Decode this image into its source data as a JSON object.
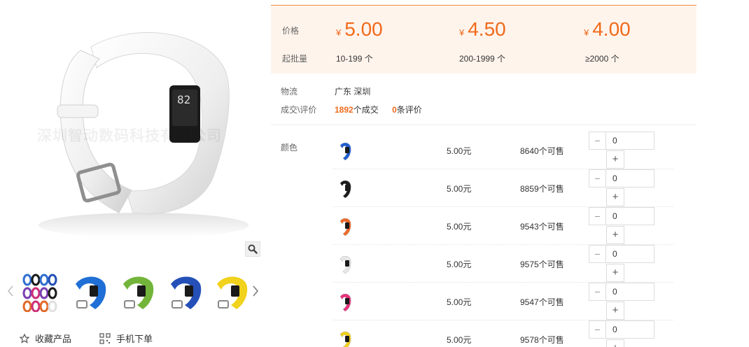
{
  "gallery": {
    "watermark": "深圳智动数码科技有限公司",
    "display_digits": "82",
    "thumbnails": [
      {
        "name": "multi-color",
        "colors": [
          "#2f6fd0",
          "#7a3fb0",
          "#e36a2a",
          "#cc2f7a",
          "#1a1a1a",
          "#e0e0e0"
        ]
      },
      {
        "name": "blue",
        "color": "#1f6fd6"
      },
      {
        "name": "green",
        "color": "#72b53a"
      },
      {
        "name": "royal-blue",
        "color": "#2450b8"
      },
      {
        "name": "yellow",
        "color": "#f1d21c"
      }
    ],
    "favorite_label": "收藏产品",
    "mobile_order_label": "手机下单"
  },
  "price_box": {
    "price_label": "价格",
    "moq_label": "起批量",
    "currency": "¥",
    "tiers": [
      {
        "price": "5.00",
        "qty": "10-199 个"
      },
      {
        "price": "4.50",
        "qty": "200-1999 个"
      },
      {
        "price": "4.00",
        "qty": "≥2000 个"
      }
    ]
  },
  "logistics": {
    "label": "物流",
    "location": "广东 深圳",
    "deals_label": "成交\\评价",
    "deals_count": "1892",
    "deals_suffix": "个成交",
    "reviews_count": "0",
    "reviews_suffix": "条评价"
  },
  "sku": {
    "color_label": "颜色",
    "rows": [
      {
        "color": "#1f5fd0",
        "price": "5.00元",
        "stock": "8640个可售",
        "qty": "0"
      },
      {
        "color": "#1c1c1c",
        "price": "5.00元",
        "stock": "8859个可售",
        "qty": "0"
      },
      {
        "color": "#ef6a2a",
        "price": "5.00元",
        "stock": "9543个可售",
        "qty": "0"
      },
      {
        "color": "#e8e8e8",
        "price": "5.00元",
        "stock": "9575个可售",
        "qty": "0"
      },
      {
        "color": "#e8337a",
        "price": "5.00元",
        "stock": "9547个可售",
        "qty": "0"
      },
      {
        "color": "#f2d21c",
        "price": "5.00元",
        "stock": "9578个可售",
        "qty": "0"
      }
    ],
    "minus_symbol": "−",
    "plus_symbol": "+"
  },
  "colors": {
    "accent": "#f06a1b",
    "price_box_bg": "#fff4ec"
  }
}
